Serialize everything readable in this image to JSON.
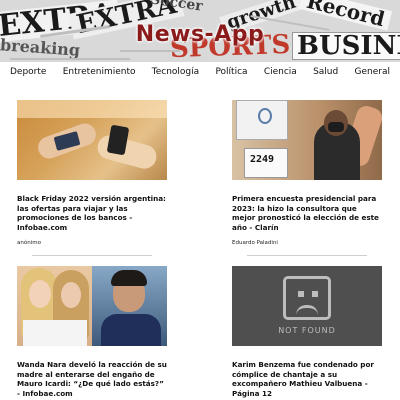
{
  "header": {
    "app_title": "News-App",
    "banner_words": [
      "EXTRA",
      "EXTRA",
      "Soccer",
      "growth",
      "Record",
      "breaking",
      "SPORTS",
      "BUSINESS"
    ]
  },
  "nav": {
    "items": [
      "Deporte",
      "Entretenimiento",
      "Tecnología",
      "Política",
      "Ciencia",
      "Salud",
      "General"
    ]
  },
  "articles": [
    {
      "headline": "Black Friday 2022 versión argentina: las ofertas para viajar y las promociones de los bancos - Infobae.com",
      "author": "anónimo"
    },
    {
      "headline": "Primera encuesta presidencial para 2023: la hizo la consultora que mejor pronosticó la elección de este año - Clarín",
      "author": "Eduardo Paladini",
      "image_text": "2249"
    },
    {
      "headline": "Wanda Nara develó la reacción de su madre al enterarse del engaño de Mauro Icardi: “¿De qué lado estás?” - Infobae.com",
      "author": ""
    },
    {
      "headline": "Karim Benzema fue condenado por cómplice de chantaje a su excompañero Mathieu Valbuena - Página 12",
      "author": "",
      "image_text": "NOT FOUND"
    }
  ],
  "colors": {
    "title": "#8b1a1a",
    "not_found_bg": "#4f4f4f"
  }
}
